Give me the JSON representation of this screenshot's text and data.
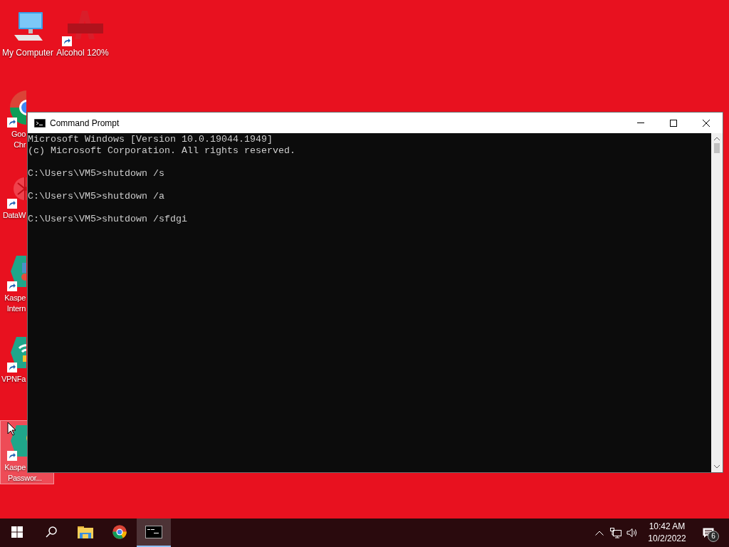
{
  "desktop_icons": [
    {
      "kind": "computer",
      "label": [
        "My Computer"
      ],
      "selected": false,
      "shortcut": false
    },
    {
      "kind": "alcohol",
      "label": [
        "Alcohol 120%"
      ],
      "selected": false,
      "shortcut": true
    },
    {
      "kind": "chrome",
      "label": [
        "Goo",
        "Chr"
      ],
      "selected": false,
      "shortcut": true
    },
    {
      "kind": "datawatch",
      "label": [
        "DataW"
      ],
      "selected": false,
      "shortcut": true
    },
    {
      "kind": "kaspersky",
      "label": [
        "Kaspe",
        "Intern"
      ],
      "selected": false,
      "shortcut": true
    },
    {
      "kind": "vpn",
      "label": [
        "VPNFa"
      ],
      "selected": false,
      "shortcut": true
    },
    {
      "kind": "password",
      "label": [
        "Kaspe",
        "Passwor..."
      ],
      "selected": true,
      "shortcut": true
    }
  ],
  "window": {
    "title": "Command Prompt",
    "console_blocks": [
      [
        "Microsoft Windows [Version 10.0.19044.1949]",
        "(c) Microsoft Corporation. All rights reserved."
      ],
      [
        "C:\\Users\\VM5>shutdown /s"
      ],
      [
        "C:\\Users\\VM5>shutdown /a"
      ],
      [
        "C:\\Users\\VM5>shutdown /sfdgi"
      ]
    ]
  },
  "taskbar": {
    "items": [
      {
        "kind": "start",
        "active": false
      },
      {
        "kind": "search",
        "active": false
      },
      {
        "kind": "explorer",
        "active": false
      },
      {
        "kind": "chrome",
        "active": false
      },
      {
        "kind": "cmd",
        "active": true
      }
    ],
    "time": "10:42 AM",
    "date": "10/2/2022",
    "notification_count": "6"
  }
}
